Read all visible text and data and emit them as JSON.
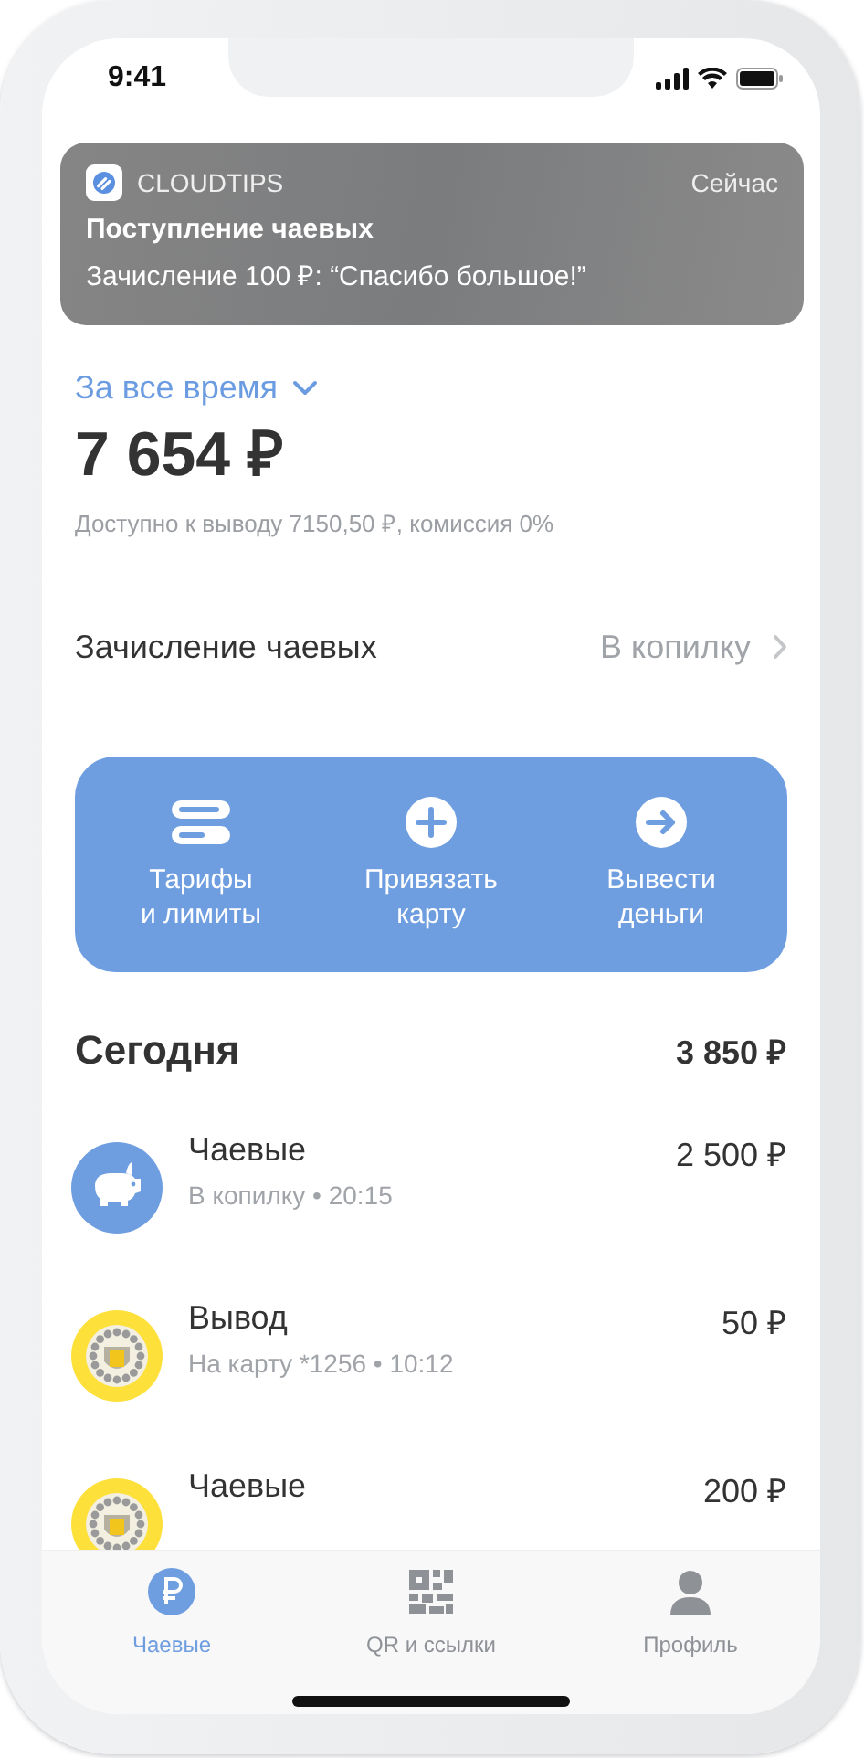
{
  "status_bar": {
    "time": "9:41"
  },
  "notification": {
    "app": "CLOUDTIPS",
    "time": "Сейчас",
    "title": "Поступление чаевых",
    "body": "Зачисление 100 ₽: “Спасибо большое!”"
  },
  "period": {
    "label": "За все время"
  },
  "balance": {
    "amount": "7 654 ₽",
    "note": "Доступно к выводу 7150,50 ₽, комиссия 0%"
  },
  "tips_setting": {
    "label": "Зачисление чаевых",
    "value": "В копилку"
  },
  "actions": [
    {
      "kind": "tariffs",
      "label": "Тарифы\nи лимиты"
    },
    {
      "kind": "add",
      "label": "Привязать\nкарту"
    },
    {
      "kind": "withdraw",
      "label": "Вывести\nденьги"
    }
  ],
  "today": {
    "title": "Сегодня",
    "total": "3 850 ₽"
  },
  "transactions": [
    {
      "kind": "piggy",
      "title": "Чаевые",
      "subtitle": "В копилку • 20:15",
      "amount": "2 500 ₽"
    },
    {
      "kind": "emblem",
      "title": "Вывод",
      "subtitle": "На карту *1256 • 10:12",
      "amount": "50 ₽"
    },
    {
      "kind": "emblem",
      "title": "Чаевые",
      "amount": "200 ₽"
    }
  ],
  "tab_bar": [
    {
      "kind": "ruble",
      "label": "Чаевые",
      "selected": true
    },
    {
      "kind": "qr",
      "label": "QR и ссылки",
      "selected": false
    },
    {
      "kind": "profile",
      "label": "Профиль",
      "selected": false
    }
  ]
}
